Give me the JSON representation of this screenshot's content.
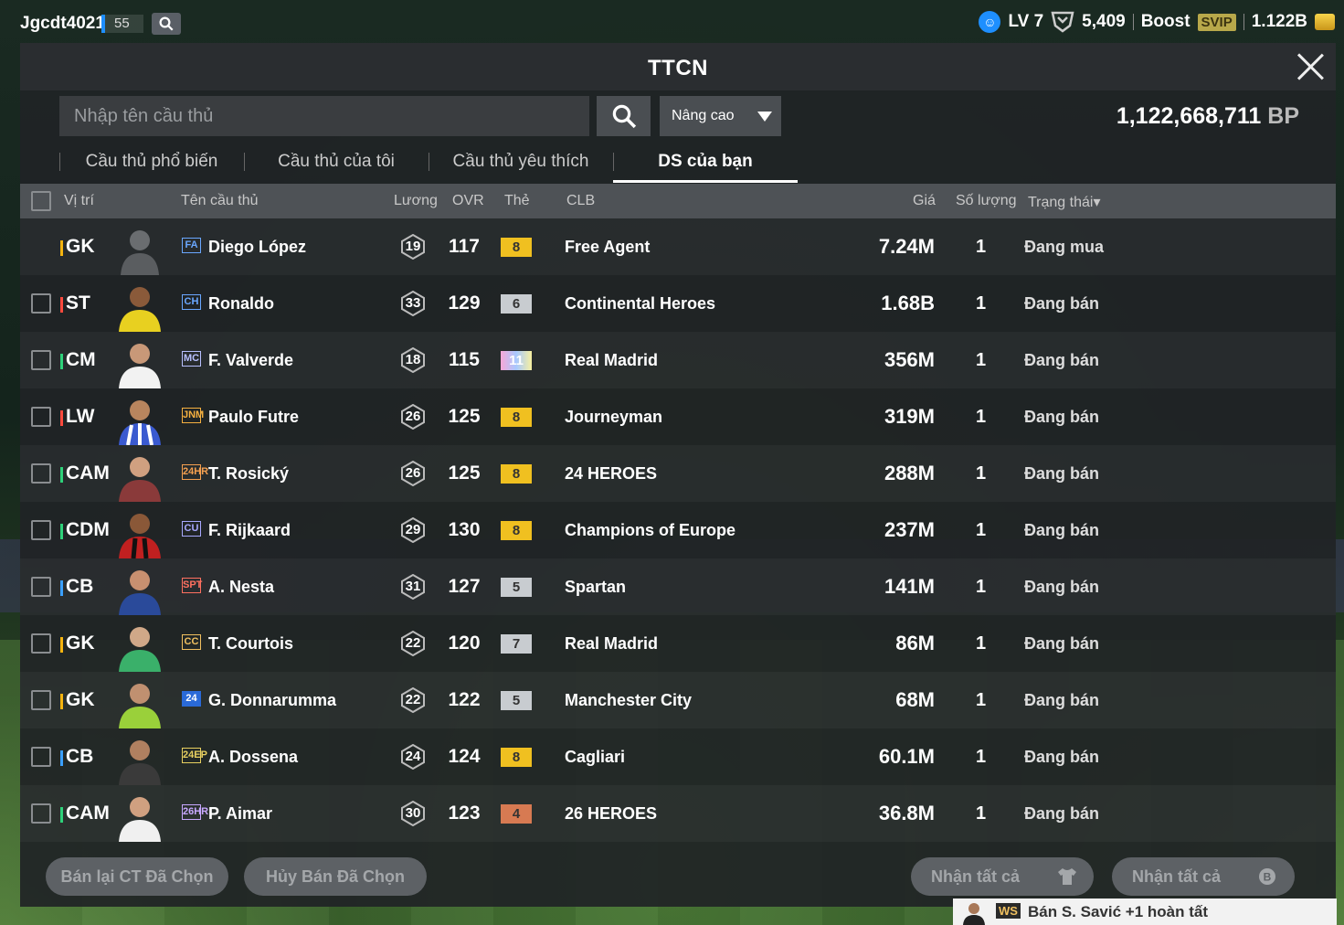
{
  "topbar": {
    "username": "Jgcdt4021",
    "level_badge": "55",
    "lv": "LV 7",
    "points": "5,409",
    "boost": "Boost",
    "svip": "SVIP",
    "balance": "1.122B"
  },
  "panel": {
    "title": "TTCN",
    "search_placeholder": "Nhập tên cầu thủ",
    "advanced": "Nâng cao",
    "bp_value": "1,122,668,711",
    "bp_unit": "BP"
  },
  "tabs": [
    {
      "label": "Cầu thủ phổ biến"
    },
    {
      "label": "Cầu thủ của tôi"
    },
    {
      "label": "Cầu thủ yêu thích"
    },
    {
      "label": "DS của bạn"
    }
  ],
  "table": {
    "headers": {
      "position": "Vị trí",
      "name": "Tên cầu thủ",
      "salary": "Lương",
      "ovr": "OVR",
      "grade": "Thẻ",
      "club": "CLB",
      "price": "Giá",
      "qty": "Số lượng",
      "status": "Trạng thái▾"
    },
    "rows": [
      {
        "pos": "GK",
        "season": "FA",
        "name": "Diego López",
        "salary": "19",
        "ovr": "117",
        "grade": "8",
        "club": "Free Agent",
        "price": "7.24M",
        "qty": "1",
        "status": "Đang mua"
      },
      {
        "pos": "ST",
        "season": "CH",
        "name": "Ronaldo",
        "salary": "33",
        "ovr": "129",
        "grade": "6",
        "club": "Continental Heroes",
        "price": "1.68B",
        "qty": "1",
        "status": "Đang bán"
      },
      {
        "pos": "CM",
        "season": "MC",
        "name": "F. Valverde",
        "salary": "18",
        "ovr": "115",
        "grade": "11",
        "club": "Real Madrid",
        "price": "356M",
        "qty": "1",
        "status": "Đang bán"
      },
      {
        "pos": "LW",
        "season": "JNM",
        "name": "Paulo Futre",
        "salary": "26",
        "ovr": "125",
        "grade": "8",
        "club": "Journeyman",
        "price": "319M",
        "qty": "1",
        "status": "Đang bán"
      },
      {
        "pos": "CAM",
        "season": "24HR",
        "name": "T. Rosický",
        "salary": "26",
        "ovr": "125",
        "grade": "8",
        "club": "24 HEROES",
        "price": "288M",
        "qty": "1",
        "status": "Đang bán"
      },
      {
        "pos": "CDM",
        "season": "CU",
        "name": "F. Rijkaard",
        "salary": "29",
        "ovr": "130",
        "grade": "8",
        "club": "Champions of Europe",
        "price": "237M",
        "qty": "1",
        "status": "Đang bán"
      },
      {
        "pos": "CB",
        "season": "SPT",
        "name": "A. Nesta",
        "salary": "31",
        "ovr": "127",
        "grade": "5",
        "club": "Spartan",
        "price": "141M",
        "qty": "1",
        "status": "Đang bán"
      },
      {
        "pos": "GK",
        "season": "CC",
        "name": "T. Courtois",
        "salary": "22",
        "ovr": "120",
        "grade": "7",
        "club": "Real Madrid",
        "price": "86M",
        "qty": "1",
        "status": "Đang bán"
      },
      {
        "pos": "GK",
        "season": "24",
        "name": "G. Donnarumma",
        "salary": "22",
        "ovr": "122",
        "grade": "5",
        "club": "Manchester City",
        "price": "68M",
        "qty": "1",
        "status": "Đang bán"
      },
      {
        "pos": "CB",
        "season": "24EP",
        "name": "A. Dossena",
        "salary": "24",
        "ovr": "124",
        "grade": "8",
        "club": "Cagliari",
        "price": "60.1M",
        "qty": "1",
        "status": "Đang bán"
      },
      {
        "pos": "CAM",
        "season": "26HR",
        "name": "P. Aimar",
        "salary": "30",
        "ovr": "123",
        "grade": "4",
        "club": "26 HEROES",
        "price": "36.8M",
        "qty": "1",
        "status": "Đang bán"
      }
    ]
  },
  "actions": {
    "resell": "Bán lại CT Đã Chọn",
    "cancel": "Hủy Bán Đã Chọn",
    "claim_all_1": "Nhận tất cả",
    "claim_all_2": "Nhận tất cả"
  },
  "notification": {
    "badge": "WS",
    "text": "Bán S. Savić +1 hoàn tất"
  },
  "colors": {
    "pos_gk": "#f5b40f",
    "pos_att": "#ff4a3d",
    "pos_mid": "#2ed27a",
    "pos_def": "#3aa0ff",
    "grade_gold": "#f0c020",
    "grade_silver": "#c8ccd0",
    "grade_bronze": "#d77a52"
  }
}
